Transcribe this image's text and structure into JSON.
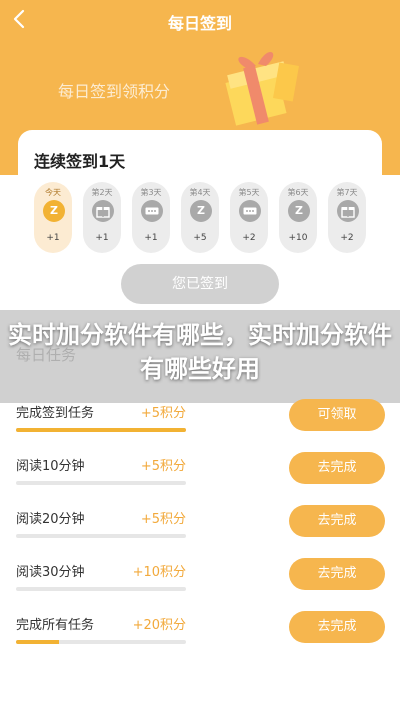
{
  "header": {
    "title": "每日签到",
    "subtitle": "每日签到领积分",
    "back_icon": "chevron-left-icon",
    "gift_icon": "gift-box-icon"
  },
  "streak_card": {
    "title": "连续签到1天",
    "days": [
      {
        "label": "今天",
        "points": "+1",
        "icon": "coin-z-icon",
        "active": true
      },
      {
        "label": "第2天",
        "points": "+1",
        "icon": "gift-icon",
        "active": false
      },
      {
        "label": "第3天",
        "points": "+1",
        "icon": "ticket-icon",
        "active": false
      },
      {
        "label": "第4天",
        "points": "+5",
        "icon": "coin-z-icon",
        "active": false
      },
      {
        "label": "第5天",
        "points": "+2",
        "icon": "ticket-icon",
        "active": false
      },
      {
        "label": "第6天",
        "points": "+10",
        "icon": "coin-z-icon",
        "active": false
      },
      {
        "label": "第7天",
        "points": "+2",
        "icon": "gift-icon",
        "active": false
      }
    ],
    "signed_button": "您已签到"
  },
  "banner": {
    "text": "实时加分软件有哪些，实时加分软件有哪些好用"
  },
  "tasks": {
    "header": "每日任务",
    "items": [
      {
        "name": "完成签到任务",
        "points": "+5积分",
        "button": "可领取",
        "progress": 1.0
      },
      {
        "name": "阅读10分钟",
        "points": "+5积分",
        "button": "去完成",
        "progress": 0
      },
      {
        "name": "阅读20分钟",
        "points": "+5积分",
        "button": "去完成",
        "progress": 0
      },
      {
        "name": "阅读30分钟",
        "points": "+10积分",
        "button": "去完成",
        "progress": 0
      },
      {
        "name": "完成所有任务",
        "points": "+20积分",
        "button": "去完成",
        "progress": 0.25
      }
    ]
  },
  "colors": {
    "accent": "#F6B64E",
    "points_text": "#F2A93B",
    "disabled": "#D1D1D1"
  }
}
